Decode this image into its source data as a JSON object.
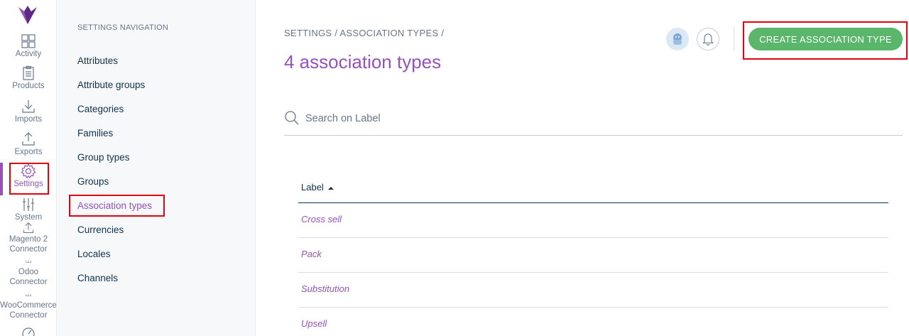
{
  "rail": {
    "items": [
      {
        "label": "Activity",
        "icon": "dashboard-grid-icon"
      },
      {
        "label": "Products",
        "icon": "clipboard-icon"
      },
      {
        "label": "Imports",
        "icon": "import-icon"
      },
      {
        "label": "Exports",
        "icon": "export-icon"
      },
      {
        "label": "Settings",
        "icon": "gear-icon"
      },
      {
        "label": "System",
        "icon": "sliders-icon"
      },
      {
        "label": "Magento 2",
        "icon": "export-icon"
      },
      {
        "label": "Connector",
        "icon": "connector-icon"
      },
      {
        "label": "Odoo",
        "icon": "connector-icon"
      },
      {
        "label": "Connector",
        "icon": "connector-icon"
      },
      {
        "label": "WooCommerce",
        "icon": "connector-icon"
      },
      {
        "label": "Connector",
        "icon": "gauge-icon"
      }
    ],
    "active": "Settings"
  },
  "subnav": {
    "title": "SETTINGS NAVIGATION",
    "items": [
      "Attributes",
      "Attribute groups",
      "Categories",
      "Families",
      "Group types",
      "Groups",
      "Association types",
      "Currencies",
      "Locales",
      "Channels"
    ],
    "active": "Association types"
  },
  "header": {
    "breadcrumb": "SETTINGS / ASSOCIATION TYPES /",
    "title": "4 association types",
    "create_label": "CREATE ASSOCIATION TYPE"
  },
  "search": {
    "placeholder": "Search on Label",
    "value": ""
  },
  "table": {
    "columns": [
      "Label"
    ],
    "rows": [
      "Cross sell",
      "Pack",
      "Substitution",
      "Upsell"
    ]
  },
  "colors": {
    "accent": "#9452ba",
    "primary_button": "#5ab66a",
    "highlight_box": "#e3000f"
  }
}
